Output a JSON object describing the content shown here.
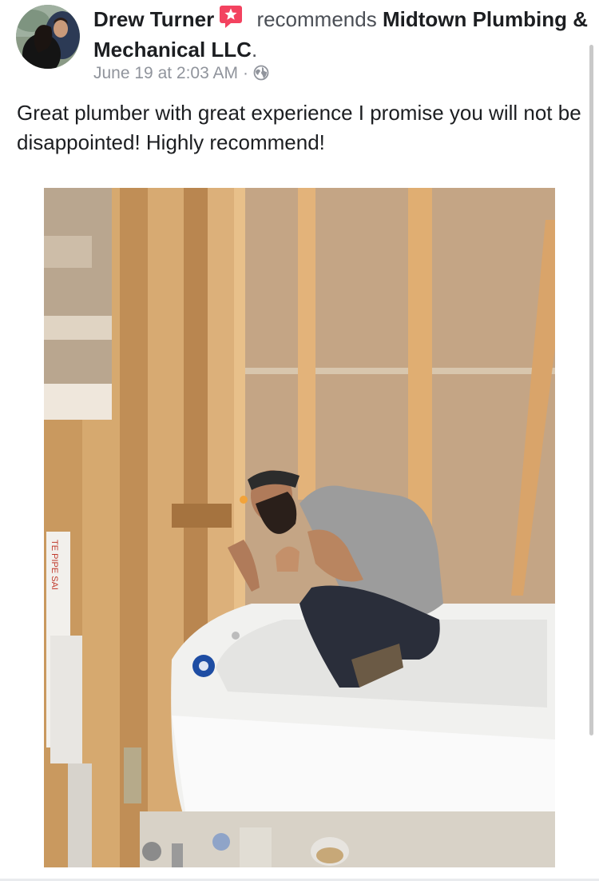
{
  "post": {
    "author": "Drew Turner",
    "action": " recommends ",
    "page": "Midtown Plumbing & Mechanical LLC",
    "page_end": ".",
    "timestamp": "June 19 at 2:03 AM",
    "separator": "·",
    "privacy_icon": "globe-icon",
    "recommend_icon": "recommend-star-icon",
    "body": "Great plumber with great experience I promise you will not be disappointed! Highly recommend!",
    "photo_pipe_text": "TE PIPE SAI"
  },
  "colors": {
    "text_primary": "#1c1e21",
    "text_secondary": "#4b4f56",
    "meta": "#90949c",
    "recommend_badge": "#f3425f"
  }
}
